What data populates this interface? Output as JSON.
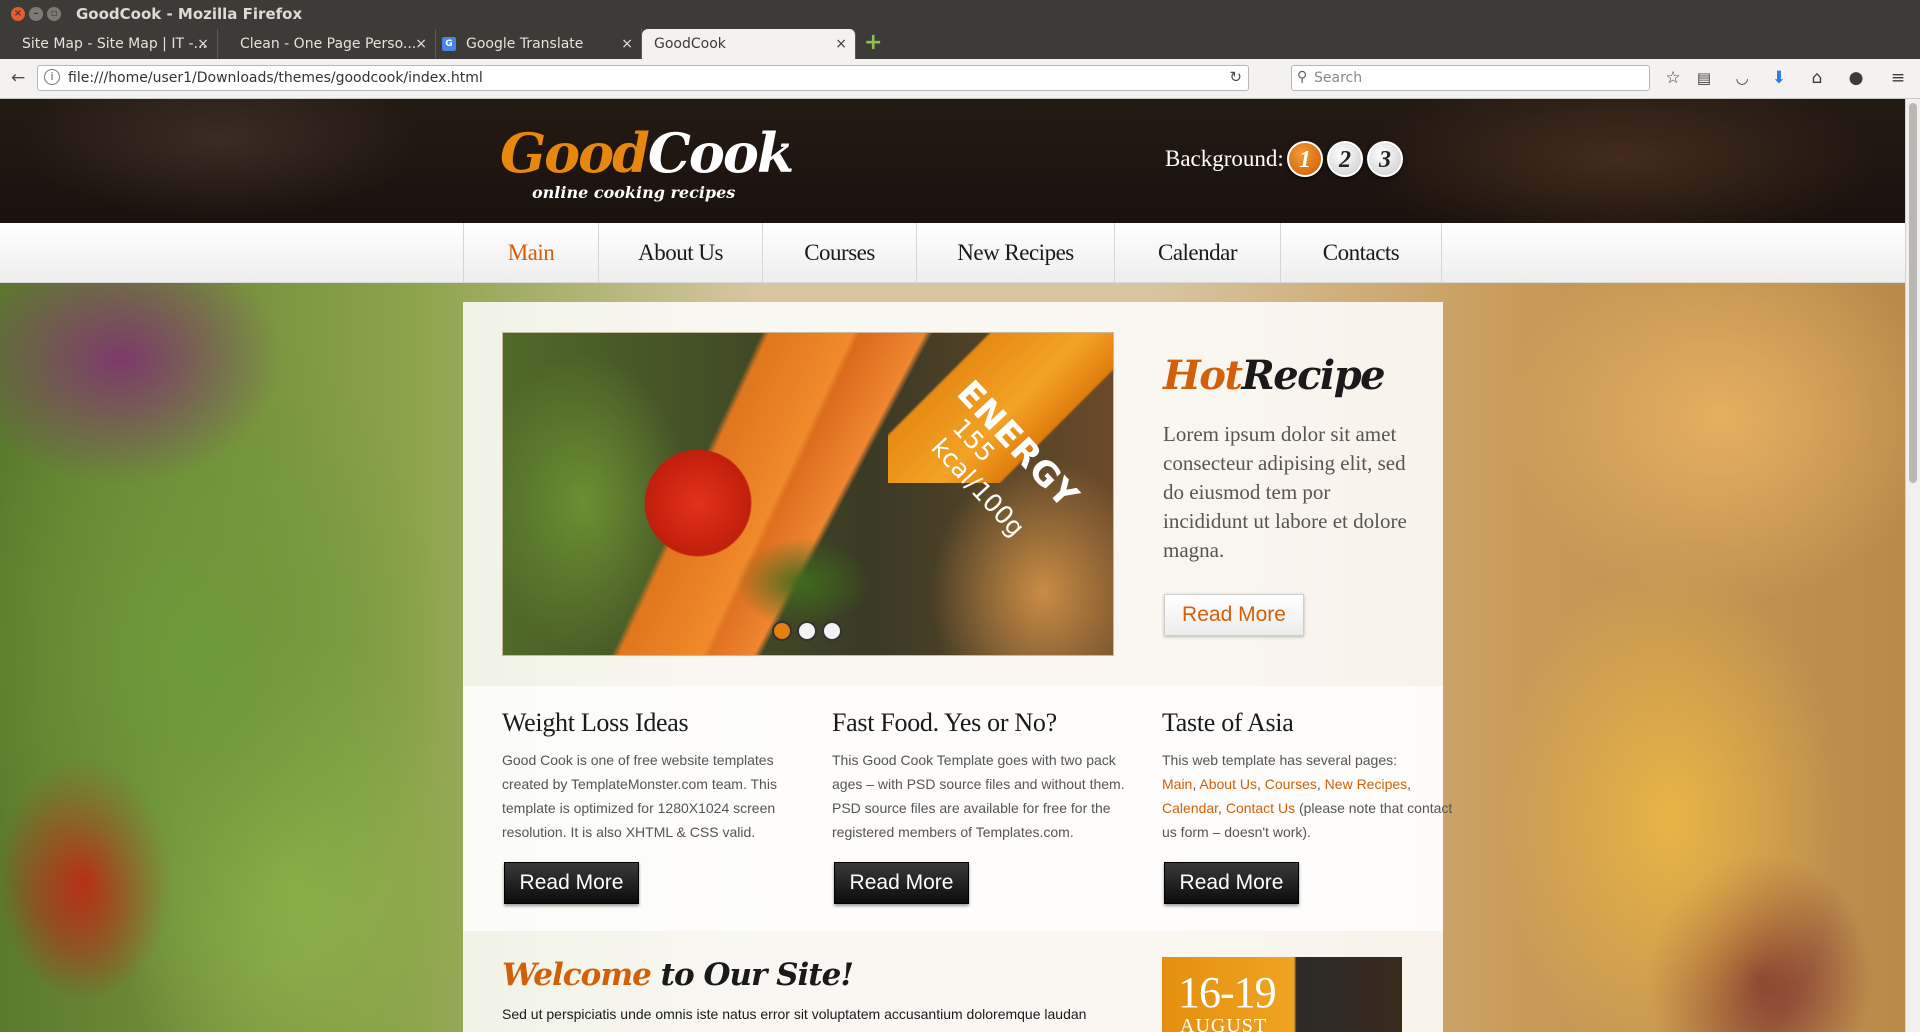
{
  "window": {
    "title": "GoodCook - Mozilla Firefox"
  },
  "tabs": [
    {
      "label": "Site Map - Site Map | IT -...",
      "active": false
    },
    {
      "label": "Clean - One Page Perso...",
      "active": false
    },
    {
      "label": "Google Translate",
      "active": false
    },
    {
      "label": "GoodCook",
      "active": true
    }
  ],
  "tab_close_glyph": "×",
  "new_tab_glyph": "+",
  "toolbar": {
    "url": "file:///home/user1/Downloads/themes/goodcook/index.html",
    "search_placeholder": "Search",
    "icons": [
      "back-icon",
      "info-icon",
      "reload-icon",
      "bookmark-star-icon",
      "reading-list-icon",
      "pocket-icon",
      "download-icon",
      "home-icon",
      "chat-icon",
      "menu-icon"
    ]
  },
  "site": {
    "logo_good": "Good",
    "logo_cook": "Cook",
    "logo_tagline": "online cooking recipes",
    "background_label": "Background:",
    "background_options": [
      "1",
      "2",
      "3"
    ],
    "background_selected": "1",
    "accent_color": "#d2600a",
    "nav": [
      {
        "label": "Main",
        "active": true
      },
      {
        "label": "About Us",
        "active": false
      },
      {
        "label": "Courses",
        "active": false
      },
      {
        "label": "New Recipes",
        "active": false
      },
      {
        "label": "Calendar",
        "active": false
      },
      {
        "label": "Contacts",
        "active": false
      }
    ],
    "slider": {
      "ribbon_title": "ENERGY",
      "ribbon_value": "155 kcal/100g",
      "dots": 3,
      "active_dot": 1
    },
    "hot_recipe": {
      "title_part1": "Hot",
      "title_part2": "Recipe",
      "text": "Lorem ipsum dolor sit amet consecteur adipising elit, sed do eiusmod tem por incididunt ut labore et dolore magna.",
      "button": "Read More"
    },
    "columns": [
      {
        "title": "Weight Loss Ideas",
        "text": "Good Cook is one of free website templates created by TemplateMonster.com team. This template is optimized for 1280X1024 screen resolution. It is also XHTML & CSS valid.",
        "button": "Read More"
      },
      {
        "title": "Fast Food. Yes or No?",
        "text": "This Good Cook Template goes with two pack ages – with PSD source files and without them. PSD source files are available for free for the registered members of Templates.com.",
        "button": "Read More"
      },
      {
        "title": "Taste of Asia",
        "text_intro": "This web template has several pages:",
        "links": [
          "Main",
          "About Us",
          "Courses",
          "New Recipes",
          "Calendar",
          "Contact Us"
        ],
        "text_outro": "(please note that contact us form – doesn't work).",
        "button": "Read More"
      }
    ],
    "welcome": {
      "title_part1": "Welcome",
      "title_part2": "to Our Site!",
      "text": "Sed ut perspiciatis unde omnis iste natus error sit voluptatem accusantium doloremque laudan"
    },
    "event": {
      "date": "16-19",
      "month": "AUGUST"
    }
  }
}
